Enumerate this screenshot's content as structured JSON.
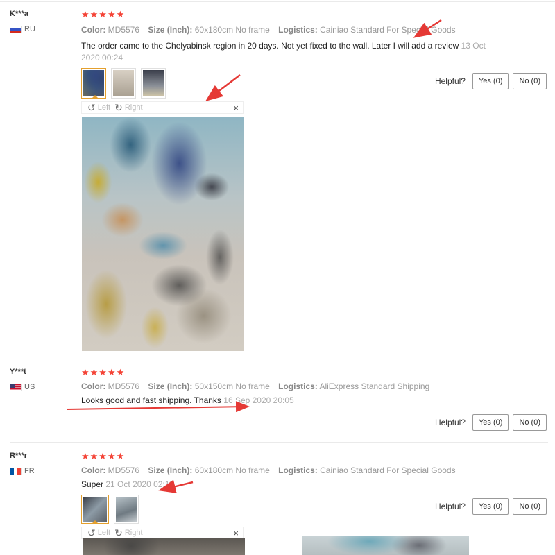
{
  "labels": {
    "color": "Color:",
    "size": "Size (Inch):",
    "logistics": "Logistics:",
    "helpful": "Helpful?",
    "rotate_left": "Left",
    "rotate_right": "Right",
    "close": "×",
    "stars": "★★★★★"
  },
  "reviews": [
    {
      "user": "K***a",
      "country": "RU",
      "rating": 5,
      "color": "MD5576",
      "size": "60x180cm No frame",
      "logistics": "Cainiao Standard For Special Goods",
      "feedback": "The order came to the Chelyabinsk region in 20 days. Not yet fixed to the wall. Later I will add a review",
      "date": "13 Oct 2020",
      "time": "00:24",
      "yes": "Yes (0)",
      "no": "No (0)"
    },
    {
      "user": "Y***t",
      "country": "US",
      "rating": 5,
      "color": "MD5576",
      "size": "50x150cm No frame",
      "logistics": "AliExpress Standard Shipping",
      "feedback": "Looks good and fast shipping. Thanks",
      "date": "16 Sep 2020 20:05",
      "yes": "Yes (0)",
      "no": "No (0)"
    },
    {
      "user": "R***r",
      "country": "FR",
      "rating": 5,
      "color": "MD5576",
      "size": "60x180cm No frame",
      "logistics": "Cainiao Standard For Special Goods",
      "feedback": "Super",
      "date": "21 Oct 2020 02:11",
      "yes": "Yes (0)",
      "no": "No (0)"
    }
  ],
  "colors": {
    "star": "#f44336",
    "annotation_arrow": "#e53935",
    "active_thumb": "#e4a02e"
  }
}
